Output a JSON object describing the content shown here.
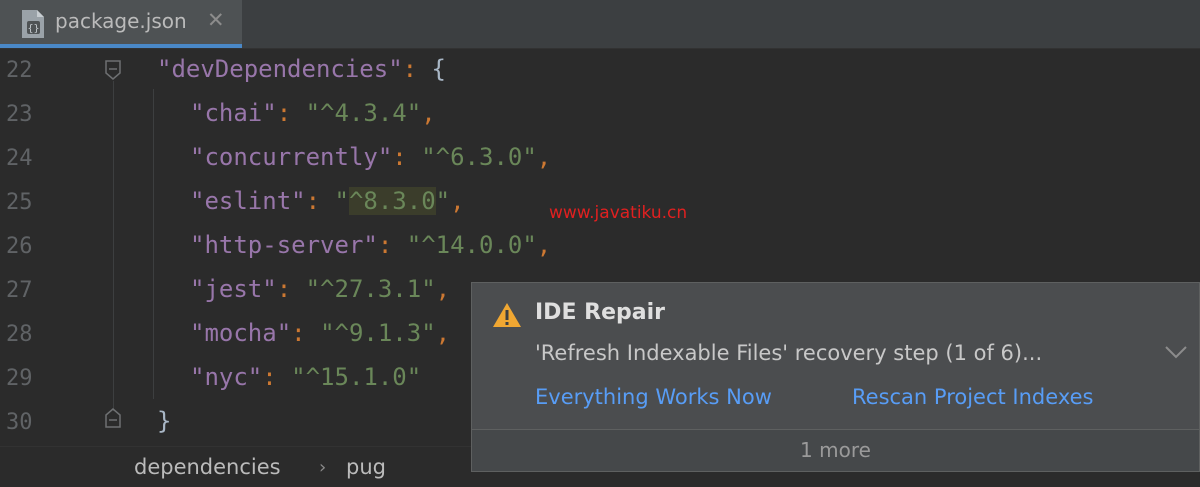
{
  "tab": {
    "file_name": "package.json",
    "close_glyph": "✕",
    "file_icon": "json-file-icon"
  },
  "gutter": {
    "line_numbers": [
      "22",
      "23",
      "24",
      "25",
      "26",
      "27",
      "28",
      "29",
      "30"
    ]
  },
  "code": {
    "line22": {
      "key": "\"devDependencies\"",
      "colon": ": ",
      "brace": "{"
    },
    "line23": {
      "key": "\"chai\"",
      "colon": ": ",
      "value": "\"^4.3.4\"",
      "comma": ","
    },
    "line24": {
      "key": "\"concurrently\"",
      "colon": ": ",
      "value": "\"^6.3.0\"",
      "comma": ","
    },
    "line25": {
      "key": "\"eslint\"",
      "colon": ": ",
      "q1": "\"",
      "value_hl": "^8.3.0",
      "q2": "\"",
      "comma": ","
    },
    "line26": {
      "key": "\"http-server\"",
      "colon": ": ",
      "value": "\"^14.0.0\"",
      "comma": ","
    },
    "line27": {
      "key": "\"jest\"",
      "colon": ": ",
      "value": "\"^27.3.1\"",
      "comma": ","
    },
    "line28": {
      "key": "\"mocha\"",
      "colon": ": ",
      "value": "\"^9.1.3\"",
      "comma": ","
    },
    "line29": {
      "key": "\"nyc\"",
      "colon": ": ",
      "value": "\"^15.1.0\""
    },
    "line30": {
      "brace": "}"
    }
  },
  "breadcrumb": {
    "items": [
      "dependencies",
      "pug"
    ],
    "separator": "›"
  },
  "notification": {
    "title": "IDE Repair",
    "message": "'Refresh Indexable Files' recovery step (1 of 6)...",
    "actions": [
      "Everything Works Now",
      "Rescan Project Indexes"
    ],
    "more": "1 more",
    "icon": "warning-icon",
    "expand_icon": "chevron-down-icon"
  },
  "watermark": "www.javatiku.cn",
  "colors": {
    "editor_bg": "#2b2b2b",
    "key": "#9876aa",
    "string": "#6a8759",
    "punctuation": "#cc7832",
    "link": "#589df6",
    "warning": "#f0a732",
    "tab_accent": "#4a88c7"
  }
}
